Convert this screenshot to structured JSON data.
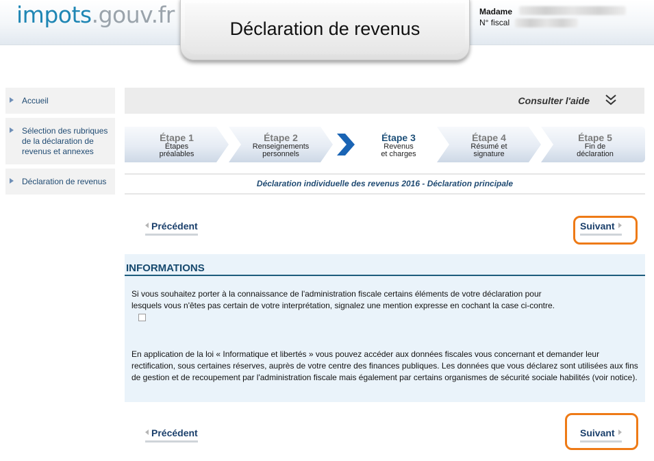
{
  "header": {
    "logo_part1": "impots",
    "logo_part2": ".gouv.fr",
    "title": "Déclaration de revenus",
    "user_title": "Madame",
    "fiscal_label": "N° fiscal"
  },
  "sidebar": {
    "items": [
      {
        "label": "Accueil"
      },
      {
        "label": "Sélection des rubriques de la déclaration de revenus et annexes"
      },
      {
        "label": "Déclaration de revenus"
      }
    ]
  },
  "help": {
    "label": "Consulter l'aide"
  },
  "steps": [
    {
      "title": "Étape 1",
      "line1": "Étapes",
      "line2": "préalables"
    },
    {
      "title": "Étape 2",
      "line1": "Renseignements",
      "line2": "personnels"
    },
    {
      "title": "Étape 3",
      "line1": "Revenus",
      "line2": "et charges"
    },
    {
      "title": "Étape 4",
      "line1": "Résumé et",
      "line2": "signature"
    },
    {
      "title": "Étape 5",
      "line1": "Fin de",
      "line2": "déclaration"
    }
  ],
  "declaration_title": "Déclaration individuelle des revenus 2016 - Déclaration principale",
  "nav": {
    "previous": "Précédent",
    "next": "Suivant"
  },
  "info": {
    "heading": "INFORMATIONS",
    "paragraph1": "Si vous souhaitez porter à la connaissance de l'administration fiscale certains éléments de votre déclaration pour lesquels vous n'êtes pas certain de votre interprétation, signalez une mention expresse en cochant la case ci-contre.",
    "paragraph2": "En application de la loi « Informatique et libertés » vous pouvez accéder aux données fiscales vous concernant et demander leur rectification, sous certaines réserves, auprès de votre centre des finances publiques. Les données que vous déclarez sont utilisées aux fins de gestion et de recoupement par l'administration fiscale mais également par certains organismes de sécurité sociale habilités (voir notice)."
  },
  "colors": {
    "accent_orange": "#ee7a16",
    "brand_blue": "#1f86b4",
    "active_arrow": "#1a64b4"
  }
}
